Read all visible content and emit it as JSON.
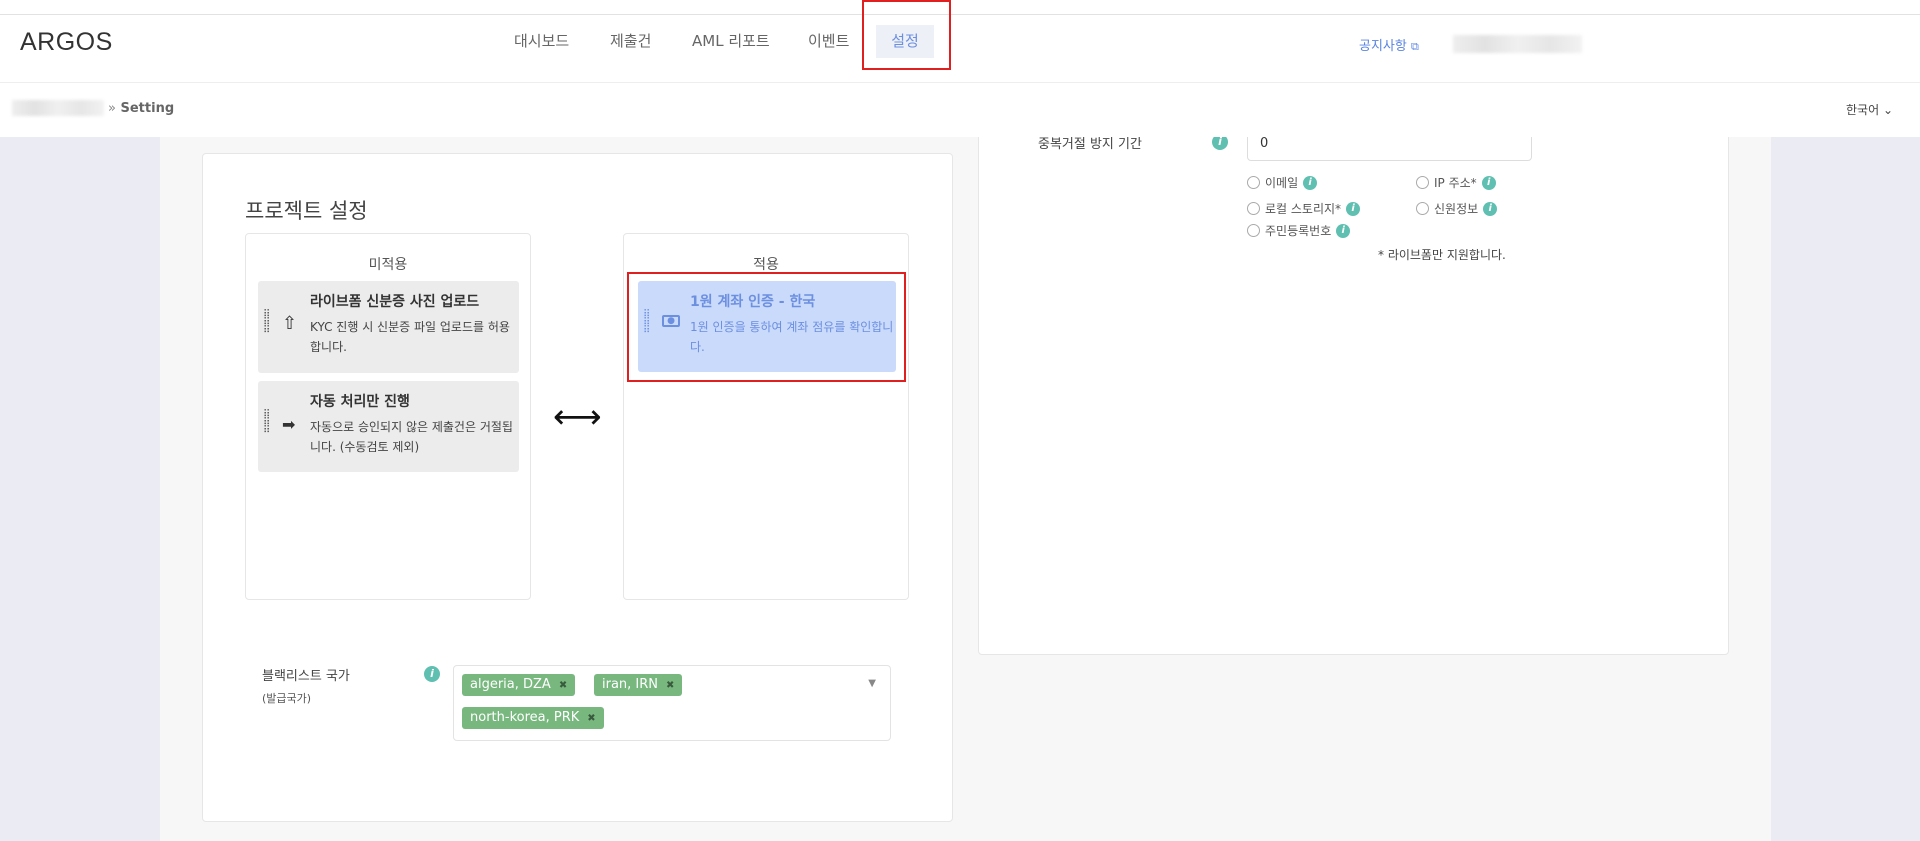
{
  "header": {
    "logo": "ARGOS",
    "nav": [
      "대시보드",
      "제출건",
      "AML 리포트",
      "이벤트",
      "설정"
    ],
    "active_nav": "설정",
    "notice": "공지사항",
    "notice_icon": "external-link-icon"
  },
  "breadcrumb": {
    "current": "Setting",
    "separator": "»"
  },
  "language": "한국어",
  "project": {
    "title": "프로젝트 설정",
    "unapplied_title": "미적용",
    "applied_title": "적용",
    "unapplied": [
      {
        "title": "라이브폼 신분증 사진 업로드",
        "desc": "KYC 진행 시 신분증 파일 업로드를 허용합니다.",
        "icon": "upload-icon"
      },
      {
        "title": "자동 처리만 진행",
        "desc": "자동으로 승인되지 않은 제출건은 거절됩니다. (수동검토 제외)",
        "icon": "arrow-right-icon"
      }
    ],
    "applied": [
      {
        "title": "1원 계좌 인증 - 한국",
        "desc": "1원 인증을 통하여 계좌 점유를 확인합니다.",
        "icon": "money-icon"
      }
    ],
    "swap_symbol": "⟷"
  },
  "blacklist": {
    "label": "블랙리스트 국가",
    "sublabel": "(발급국가)",
    "tags": [
      "algeria, DZA",
      "iran, IRN",
      "north-korea, PRK"
    ]
  },
  "duplicate": {
    "label": "중복거절 방지 기간",
    "value": "0",
    "options": [
      {
        "label": "이메일"
      },
      {
        "label": "IP 주소*"
      },
      {
        "label": "로컬 스토리지*"
      },
      {
        "label": "신원정보"
      },
      {
        "label": "주민등록번호"
      }
    ],
    "note": "* 라이브폼만 지원합니다."
  }
}
